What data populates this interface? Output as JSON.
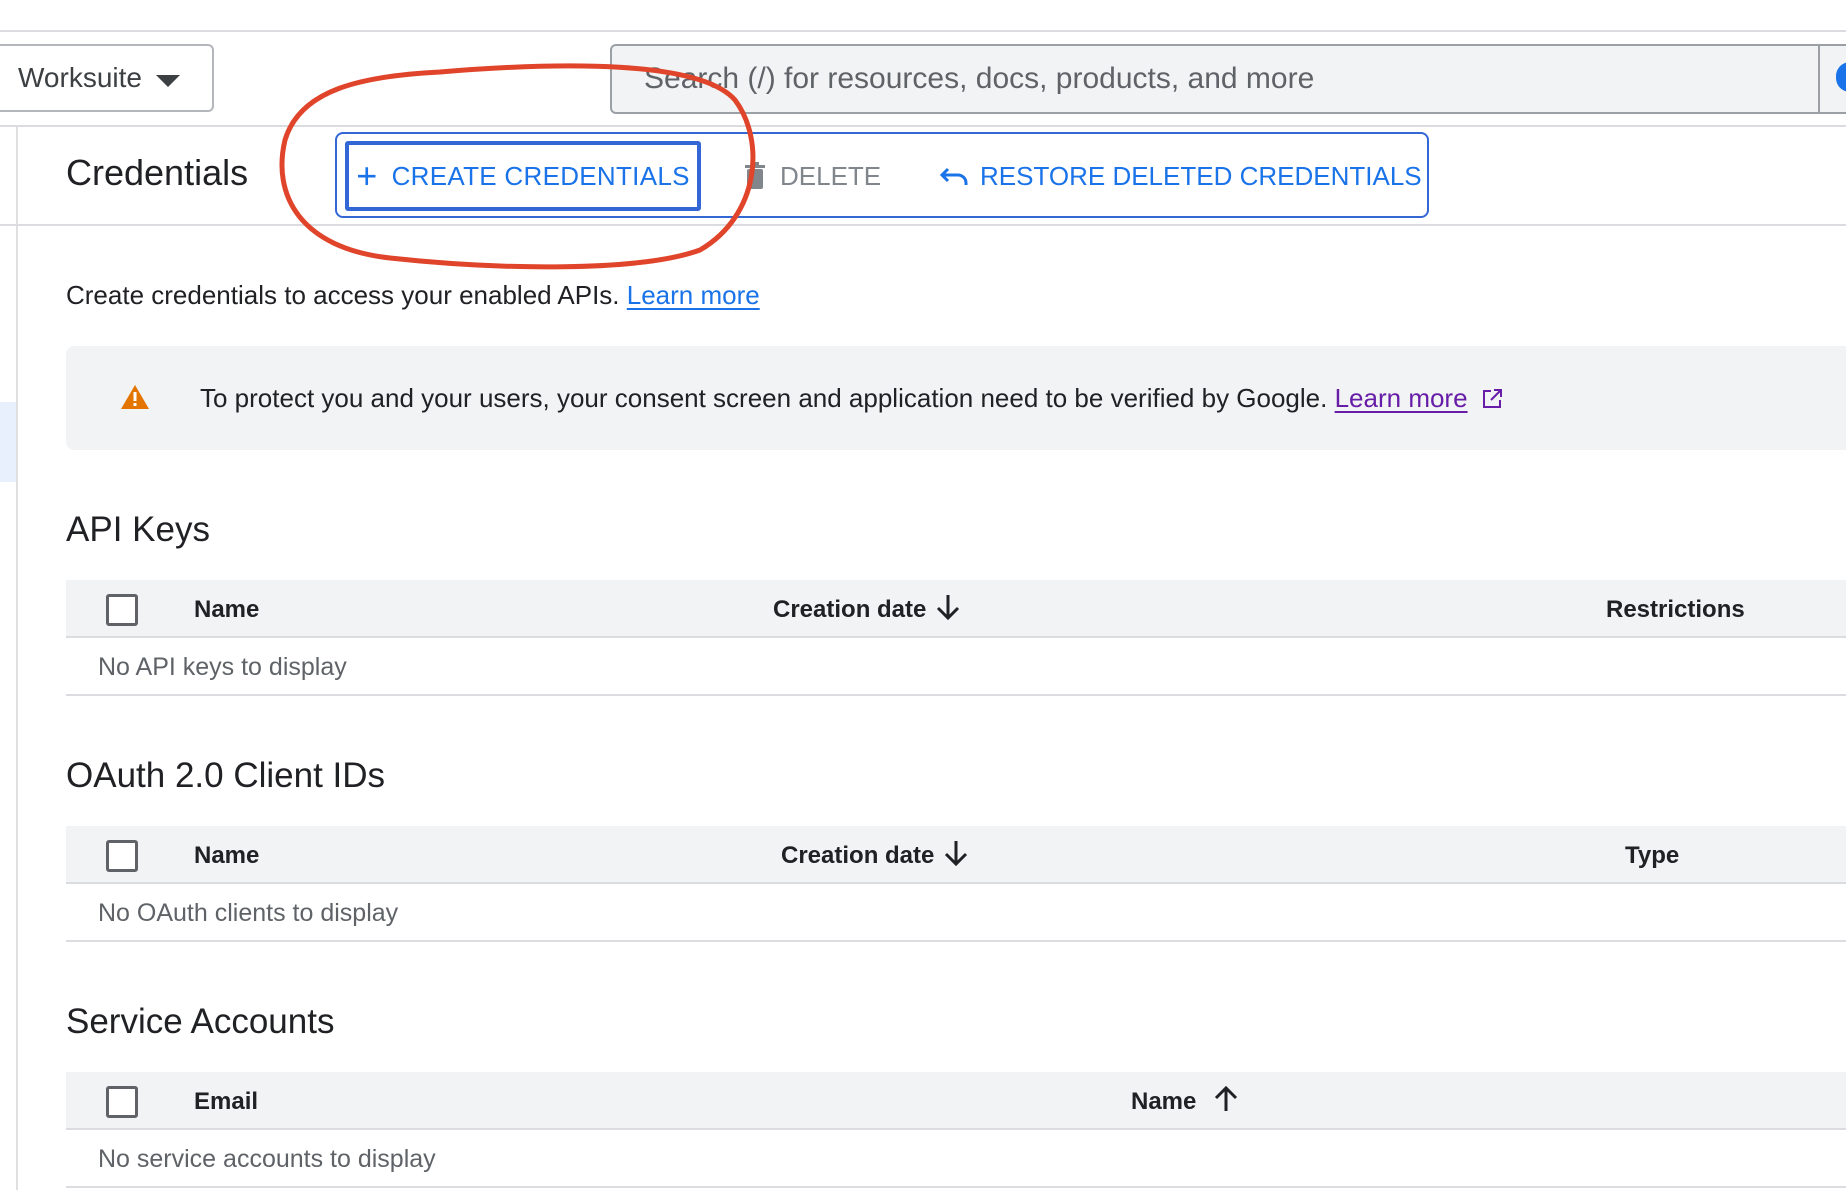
{
  "topbar": {
    "org_selector": "Worksuite",
    "search_placeholder": "Search (/) for resources, docs, products, and more"
  },
  "page": {
    "title": "Credentials",
    "actions": {
      "create": "CREATE CREDENTIALS",
      "delete": "DELETE",
      "restore": "RESTORE DELETED CREDENTIALS"
    },
    "intro_text": "Create credentials to access your enabled APIs.",
    "intro_link": "Learn more"
  },
  "banner": {
    "text": "To protect you and your users, your consent screen and application need to be verified by Google.",
    "link": "Learn more"
  },
  "api_keys": {
    "title": "API Keys",
    "columns": [
      "Name",
      "Creation date",
      "Restrictions"
    ],
    "empty": "No API keys to display"
  },
  "oauth": {
    "title": "OAuth 2.0 Client IDs",
    "columns": [
      "Name",
      "Creation date",
      "Type"
    ],
    "empty": "No OAuth clients to display"
  },
  "service_accounts": {
    "title": "Service Accounts",
    "columns": [
      "Email",
      "Name"
    ],
    "empty": "No service accounts to display"
  },
  "colors": {
    "accent": "#1a73e8",
    "annotation": "#e0452b",
    "warning": "#e37400",
    "visited_link": "#681da8"
  }
}
